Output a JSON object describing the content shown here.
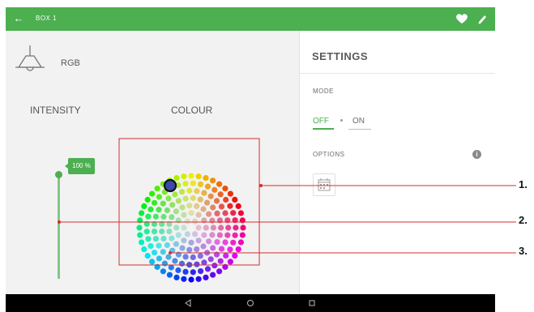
{
  "topbar": {
    "back_icon": "arrow-left-icon",
    "title": "BOX 1",
    "favorite_icon": "heart-icon",
    "edit_icon": "pencil-icon",
    "color": "#4caf50"
  },
  "left_panel": {
    "device_icon": "ceiling-lamp-icon",
    "device_label": "RGB",
    "intensity_label": "INTENSITY",
    "colour_label": "COLOUR",
    "intensity_value": "100 %",
    "intensity_level": 1.0,
    "selected_colour": "#3b4aa8"
  },
  "settings": {
    "title": "SETTINGS",
    "mode_label": "MODE",
    "mode_off": "OFF",
    "mode_on": "ON",
    "mode_selected": "OFF",
    "options_label": "OPTIONS",
    "info_icon": "info-icon",
    "calendar_icon": "calendar-icon"
  },
  "nav_bar": {
    "back_icon": "triangle-back-icon",
    "home_icon": "circle-home-icon",
    "recent_icon": "square-recent-icon"
  },
  "callouts": {
    "label_1": "1.",
    "label_2": "2.",
    "label_3": "3.",
    "line_color": "#d32f2f"
  }
}
